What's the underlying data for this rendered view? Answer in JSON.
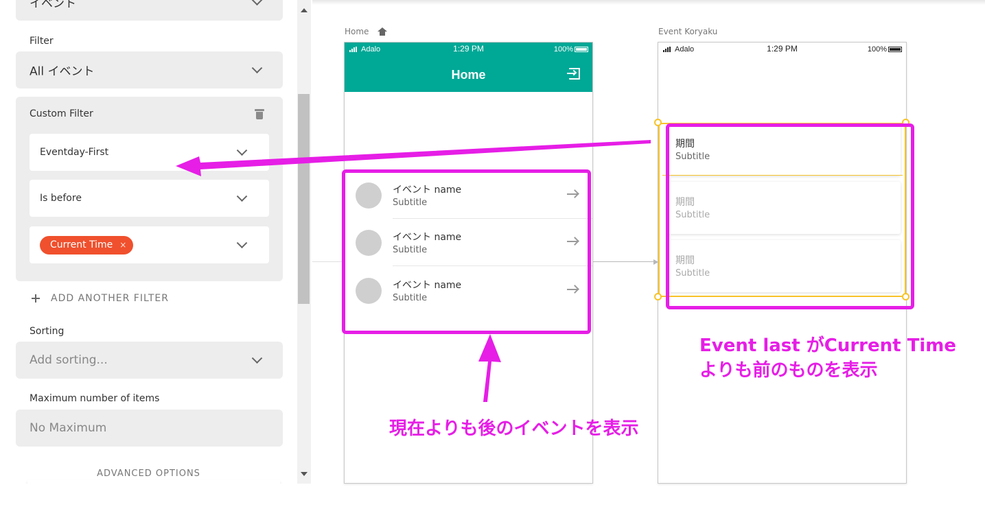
{
  "panel": {
    "top_cut_value": "イベント",
    "filter_label": "Filter",
    "filter_value": "All イベント",
    "custom_filter": {
      "title": "Custom Filter",
      "field": "Eventday-First",
      "operator": "Is before",
      "value_chip": "Current Time",
      "chip_remove": "×"
    },
    "add_filter_label": "ADD ANOTHER FILTER",
    "sorting_label": "Sorting",
    "sorting_placeholder": "Add sorting...",
    "max_items_label": "Maximum number of items",
    "max_items_value": "No Maximum",
    "advanced_options": "ADVANCED OPTIONS"
  },
  "screens": {
    "home": {
      "label": "Home",
      "status": {
        "carrier": "Adalo",
        "time": "1:29 PM",
        "battery": "100%"
      },
      "title": "Home",
      "items": [
        {
          "title": "イベント name",
          "subtitle": "Subtitle"
        },
        {
          "title": "イベント name",
          "subtitle": "Subtitle"
        },
        {
          "title": "イベント name",
          "subtitle": "Subtitle"
        }
      ]
    },
    "event": {
      "label": "Event Koryaku",
      "status": {
        "carrier": "Adalo",
        "time": "1:29 PM",
        "battery": "100%"
      },
      "cards": [
        {
          "title": "期間",
          "subtitle": "Subtitle"
        },
        {
          "title": "期間",
          "subtitle": "Subtitle"
        },
        {
          "title": "期間",
          "subtitle": "Subtitle"
        }
      ]
    }
  },
  "annotations": {
    "right_line1": "Event last がCurrent Time",
    "right_line2": "よりも前のものを表示",
    "bottom": "現在よりも後のイベントを表示"
  },
  "colors": {
    "accent_teal": "#00a896",
    "chip_red": "#f0502d",
    "annotation_magenta": "#e61ee6",
    "selection_yellow": "#f8c32a"
  }
}
